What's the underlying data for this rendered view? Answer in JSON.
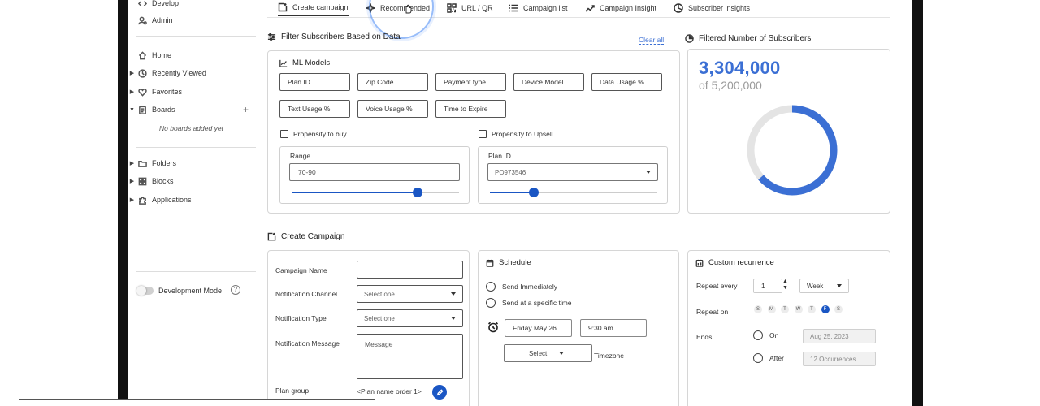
{
  "sidebar": {
    "top_items": [
      {
        "label": "Develop",
        "icon": "code-icon"
      },
      {
        "label": "Admin",
        "icon": "admin-icon"
      }
    ],
    "items": [
      {
        "label": "Home",
        "icon": "home-icon"
      },
      {
        "label": "Recently Viewed",
        "icon": "clock-icon"
      },
      {
        "label": "Favorites",
        "icon": "heart-icon"
      },
      {
        "label": "Boards",
        "icon": "board-icon"
      },
      {
        "label": "Folders",
        "icon": "folder-icon"
      },
      {
        "label": "Blocks",
        "icon": "blocks-icon"
      },
      {
        "label": "Applications",
        "icon": "puzzle-icon"
      }
    ],
    "no_boards_text": "No boards added yet",
    "add_symbol": "+",
    "dev_mode_label": "Development Mode",
    "help_symbol": "?"
  },
  "tabs": [
    {
      "label": "Create campaign",
      "icon": "create-icon",
      "active": true
    },
    {
      "label": "Recommended",
      "icon": "recommended-icon",
      "active": false
    },
    {
      "label": "URL / QR",
      "icon": "qr-icon",
      "active": false
    },
    {
      "label": "Campaign list",
      "icon": "list-icon",
      "active": false
    },
    {
      "label": "Campaign Insight",
      "icon": "insight-icon",
      "active": false
    },
    {
      "label": "Subscriber insights",
      "icon": "pie-icon",
      "active": false
    }
  ],
  "filter": {
    "title": "Filter Subscribers Based on Data",
    "clear_all": "Clear all",
    "ml_models": {
      "title": "ML Models",
      "chips": [
        "Plan ID",
        "Zip Code",
        "Payment type",
        "Device Model",
        "Data Usage %",
        "Text Usage %",
        "Voice Usage %",
        "Time to Expire"
      ]
    },
    "propensity_buy": {
      "label": "Propensity to buy",
      "range_label": "Range",
      "range_value": "70-90",
      "slider_fraction": 0.75
    },
    "propensity_upsell": {
      "label": "Propensity to Upsell",
      "plan_label": "Plan ID",
      "plan_value": "PO973546",
      "slider_fraction": 0.26
    }
  },
  "subscribers": {
    "title": "Filtered Number of Subscribers",
    "count": "3,304,000",
    "total": "of 5,200,000",
    "fraction": 0.635,
    "accent": "#3b6fd4",
    "track": "#e4e4e4"
  },
  "create_campaign": {
    "title": "Create Campaign",
    "name_label": "Campaign Name",
    "channel_label": "Notification Channel",
    "channel_placeholder": "Select one",
    "type_label": "Notification Type",
    "type_placeholder": "Select one",
    "message_label": "Notification Message",
    "message_placeholder": "Message",
    "plan_group_label": "Plan group",
    "plan_group_value": "<Plan name order 1>"
  },
  "schedule": {
    "title": "Schedule",
    "immediately": "Send Immediately",
    "specific": "Send at a specific time",
    "date": "Friday May 26",
    "time": "9:30 am",
    "tz_select": "Select",
    "tz_label": "Timezone"
  },
  "recurrence": {
    "title": "Custom recurrence",
    "repeat_every_label": "Repeat every",
    "repeat_every_value": "1",
    "period": "Week",
    "repeat_on_label": "Repeat on",
    "days": [
      "S",
      "M",
      "T",
      "W",
      "T",
      "F",
      "S"
    ],
    "selected_day_index": 5,
    "ends_label": "Ends",
    "on_label": "On",
    "on_date": "Aug 25, 2023",
    "after_label": "After",
    "after_value": "12 Occurrences"
  },
  "colors": {
    "accent": "#1a56c4",
    "link": "#3b6fd4"
  }
}
